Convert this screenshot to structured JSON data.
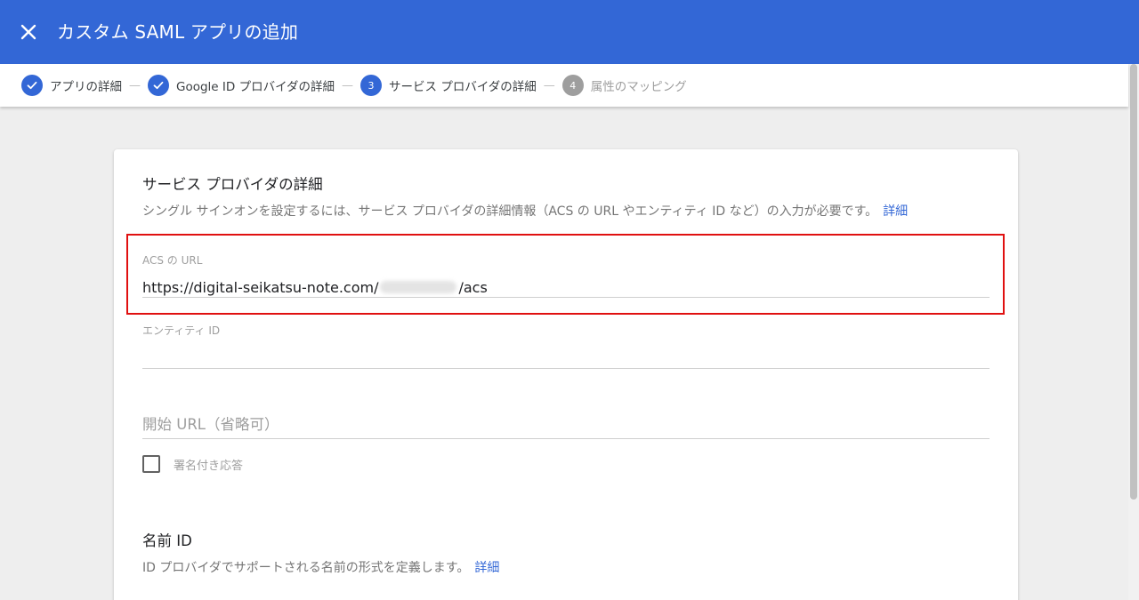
{
  "header": {
    "title": "カスタム SAML アプリの追加",
    "close_icon": "close-icon"
  },
  "stepper": {
    "steps": [
      {
        "label": "アプリの詳細",
        "state": "done"
      },
      {
        "label": "Google ID プロバイダの詳細",
        "state": "done"
      },
      {
        "number": "3",
        "label": "サービス プロバイダの詳細",
        "state": "active"
      },
      {
        "number": "4",
        "label": "属性のマッピング",
        "state": "inactive"
      }
    ],
    "separator": "—"
  },
  "section1": {
    "title": "サービス プロバイダの詳細",
    "desc": "シングル サインオンを設定するには、サービス プロバイダの詳細情報（ACS の URL やエンティティ ID など）の入力が必要です。",
    "link": "詳細"
  },
  "acs": {
    "label": "ACS の URL",
    "value_prefix": "https://digital-seikatsu-note.com/",
    "value_suffix": "/acs"
  },
  "entity": {
    "label": "エンティティ ID",
    "value": ""
  },
  "start_url": {
    "placeholder": "開始 URL（省略可）"
  },
  "signed_response": {
    "label": "署名付き応答",
    "checked": false
  },
  "section2": {
    "title": "名前 ID",
    "desc": "ID プロバイダでサポートされる名前の形式を定義します。",
    "link": "詳細"
  },
  "colors": {
    "header": "#3367d6",
    "highlight": "#e01010",
    "link": "#3367d6"
  }
}
